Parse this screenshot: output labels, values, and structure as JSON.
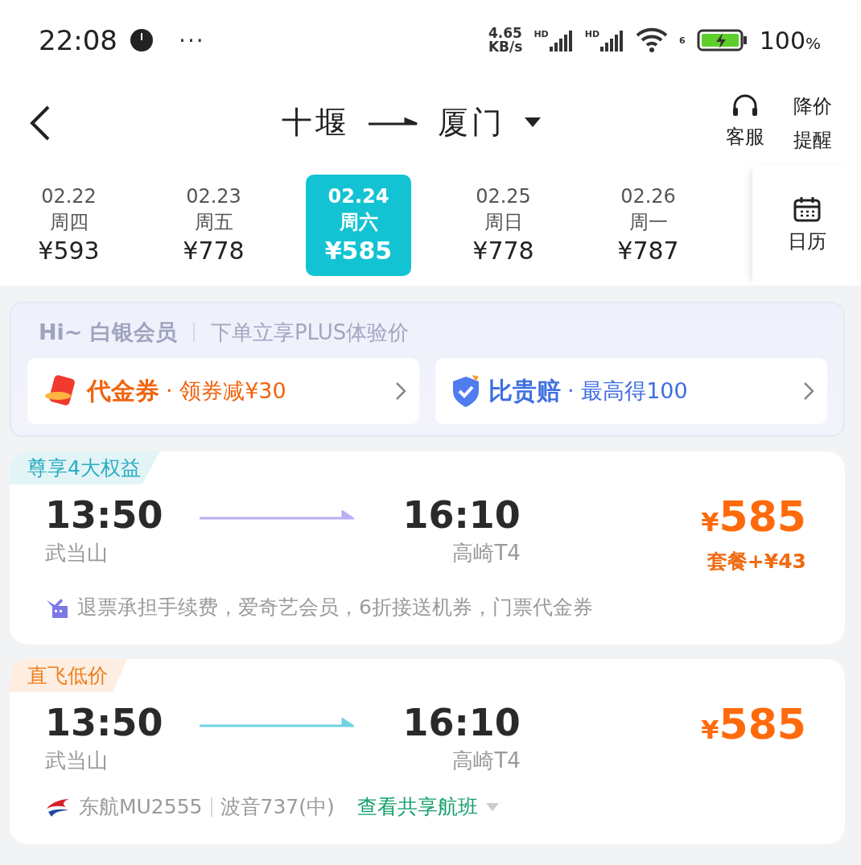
{
  "status_bar": {
    "time": "22:08",
    "more": "···",
    "net_speed": "4.65",
    "net_unit": "KB/s",
    "sims": [
      {
        "label": "HD"
      },
      {
        "label": "HD"
      }
    ],
    "wifi_label": "6",
    "battery": "100",
    "battery_unit": "%"
  },
  "header": {
    "from": "十堰",
    "to": "厦门",
    "actions": [
      {
        "kind": "service",
        "label": "客服"
      },
      {
        "kind": "alert",
        "label": "降价提醒"
      }
    ]
  },
  "dates": [
    {
      "date": "02.22",
      "weekday": "周四",
      "price": "¥593",
      "selected": false
    },
    {
      "date": "02.23",
      "weekday": "周五",
      "price": "¥778",
      "selected": false
    },
    {
      "date": "02.24",
      "weekday": "周六",
      "price": "¥585",
      "selected": true
    },
    {
      "date": "02.25",
      "weekday": "周日",
      "price": "¥778",
      "selected": false
    },
    {
      "date": "02.26",
      "weekday": "周一",
      "price": "¥787",
      "selected": false
    }
  ],
  "calendar": {
    "label": "日历"
  },
  "member": {
    "greeting": "Hi~ 白银会员",
    "slogan": "下单立享PLUS体验价",
    "offers": [
      {
        "kind": "coupon",
        "title": "代金券",
        "detail": "· 领券减¥30",
        "color": "#f0640f"
      },
      {
        "kind": "guarantee",
        "title": "比贵赔",
        "detail": "· 最高得100",
        "color": "#3f6fe0"
      }
    ]
  },
  "flights": [
    {
      "tag": {
        "text": "尊享4大权益",
        "color": "#2aaec0"
      },
      "color": "#b9aef5",
      "dep_time": "13:50",
      "dep_airport": "武当山",
      "arr_time": "16:10",
      "arr_airport": "高崎T4",
      "currency": "¥",
      "price": "585",
      "package": "套餐+¥43",
      "footer": {
        "kind": "perks",
        "text": "退票承担手续费，爱奇艺会员，6折接送机券，门票代金券"
      }
    },
    {
      "tag": {
        "text": "直飞低价",
        "color": "#ef7f1c"
      },
      "color": "#6fd3e0",
      "dep_time": "13:50",
      "dep_airport": "武当山",
      "arr_time": "16:10",
      "arr_airport": "高崎T4",
      "currency": "¥",
      "price": "585",
      "footer": {
        "kind": "airline",
        "airline": "东航MU2555",
        "plane": "波音737(中)",
        "link": "查看共享航班"
      }
    }
  ]
}
